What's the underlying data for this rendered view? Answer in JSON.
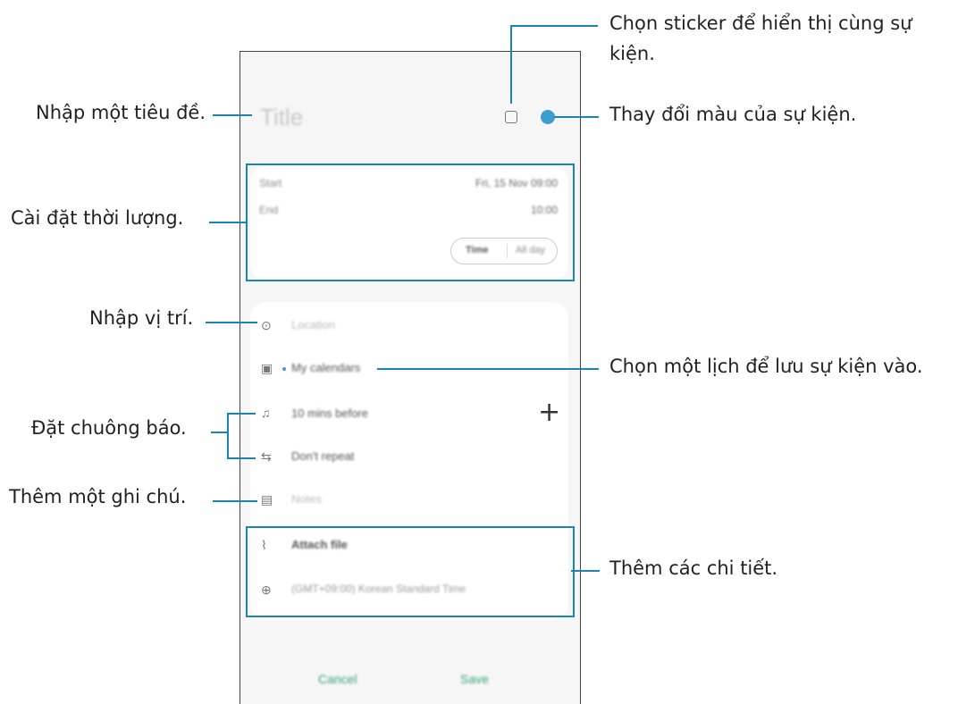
{
  "annotations": {
    "title": "Nhập một tiêu đề.",
    "duration": "Cài đặt thời lượng.",
    "location": "Nhập vị trí.",
    "alarm": "Đặt chuông báo.",
    "note": "Thêm một ghi chú.",
    "sticker_line1": "Chọn sticker để hiển thị cùng sự",
    "sticker_line2": "kiện.",
    "color": "Thay đổi màu của sự kiện.",
    "calendar": "Chọn một lịch để lưu sự kiện vào.",
    "details": "Thêm các chi tiết."
  },
  "form": {
    "title_placeholder": "Title",
    "start_label": "Start",
    "start_value": "Fri, 15 Nov 09:00",
    "end_label": "End",
    "end_value": "10:00",
    "toggle_time": "Time",
    "toggle_allday": "All day",
    "location": "Location",
    "calendar": "My calendars",
    "reminder": "10 mins before",
    "repeat": "Don't repeat",
    "notes": "Notes",
    "attach": "Attach file",
    "timezone": "(GMT+09:00) Korean Standard Time",
    "cancel": "Cancel",
    "save": "Save"
  },
  "colors": {
    "accent": "#1a84b8",
    "event_dot": "#3d9dd3",
    "action_text": "#3aa37c"
  },
  "icons": [
    "sticker-icon",
    "color-dot-icon",
    "location-pin-icon",
    "calendar-icon",
    "bell-icon",
    "repeat-icon",
    "notes-icon",
    "paperclip-icon",
    "globe-icon",
    "plus-icon"
  ]
}
